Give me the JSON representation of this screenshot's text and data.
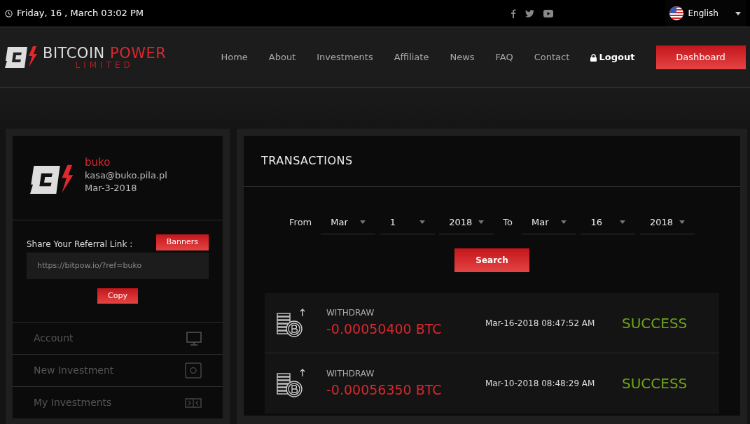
{
  "top_bar": {
    "datetime": "Friday, 16 , March 03:02 PM",
    "language": "English"
  },
  "header": {
    "logo_main": "BITCOIN",
    "logo_accent": "POWER",
    "logo_sub": "LIMITED",
    "nav": [
      {
        "label": "Home",
        "kind": "link"
      },
      {
        "label": "About",
        "kind": "link"
      },
      {
        "label": "Investments",
        "kind": "link"
      },
      {
        "label": "Affiliate",
        "kind": "link"
      },
      {
        "label": "News",
        "kind": "link"
      },
      {
        "label": "FAQ",
        "kind": "link"
      },
      {
        "label": "Contact",
        "kind": "link"
      },
      {
        "label": "Logout",
        "kind": "logout"
      },
      {
        "label": "Dashboard",
        "kind": "button"
      }
    ]
  },
  "profile": {
    "username": "buko",
    "email": "kasa@buko.pila.pl",
    "joined": "Mar-3-2018"
  },
  "referral": {
    "label": "Share Your Referral Link :",
    "banners_button": "Banners",
    "link": "https://bitpow.io/?ref=buko",
    "copy_button": "Copy"
  },
  "sidebar": {
    "items": [
      {
        "label": "Account",
        "kind": "monitor"
      },
      {
        "label": "New Investment",
        "kind": "safe"
      },
      {
        "label": "My Investments",
        "kind": "split"
      }
    ]
  },
  "transactions": {
    "title": "TRANSACTIONS",
    "from_label": "From",
    "to_label": "To",
    "from": {
      "month": "Mar",
      "day": "1",
      "year": "2018"
    },
    "to": {
      "month": "Mar",
      "day": "16",
      "year": "2018"
    },
    "search_button": "Search",
    "rows": [
      {
        "type": "WITHDRAW",
        "amount": "-0.00050400 BTC",
        "datetime": "Mar-16-2018 08:47:52 AM",
        "status": "SUCCESS"
      },
      {
        "type": "WITHDRAW",
        "amount": "-0.00056350 BTC",
        "datetime": "Mar-10-2018 08:48:29 AM",
        "status": "SUCCESS"
      }
    ]
  }
}
